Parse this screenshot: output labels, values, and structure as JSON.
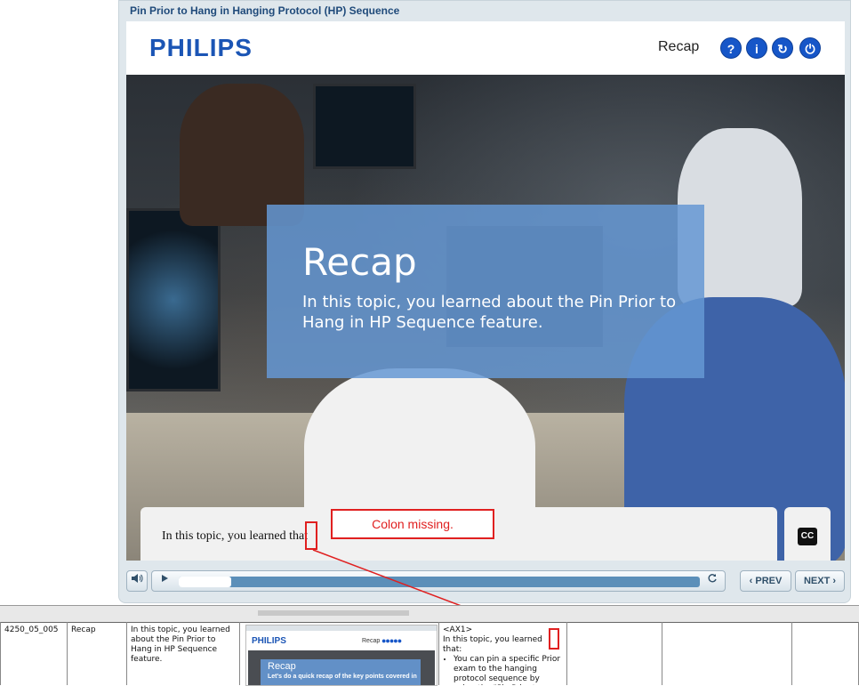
{
  "window": {
    "title": "Pin Prior to Hang in Hanging Protocol (HP) Sequence"
  },
  "header": {
    "logo": "PHILIPS",
    "section_label": "Recap",
    "buttons": [
      {
        "name": "help",
        "glyph": "?"
      },
      {
        "name": "info",
        "glyph": "i"
      },
      {
        "name": "replay",
        "glyph": "↻"
      },
      {
        "name": "exit",
        "glyph": "⏻"
      }
    ]
  },
  "slide": {
    "title": "Recap",
    "text": "In this topic, you learned about the Pin Prior to Hang in HP Sequence feature."
  },
  "caption": {
    "text": "In this topic, you learned that",
    "cc_label": "CC"
  },
  "controls": {
    "mute_icon": "speaker-icon",
    "play_icon": "play-icon",
    "progress": 0.1,
    "replay_icon": "replay-icon",
    "prev_label": "PREV",
    "next_label": "NEXT"
  },
  "annotation": {
    "comment": "Colon missing.",
    "color": "#e02020"
  },
  "storyboard_row": {
    "id": "4250_05_005",
    "screen": "Recap",
    "onscreen_text": "In this topic, you learned about the Pin Prior to Hang in HP Sequence feature.",
    "thumbnail": {
      "logo": "PHILIPS",
      "recap_label": "Recap",
      "title": "Recap",
      "text": "Let's do a quick recap of the key points covered in"
    },
    "audio_tag": "<AX1>",
    "audio_intro": "In this topic, you learned that:",
    "audio_bullets": [
      "You can pin a specific Prior exam to the hanging protocol sequence by using the \"Pin Prior to Hang in HP"
    ]
  }
}
